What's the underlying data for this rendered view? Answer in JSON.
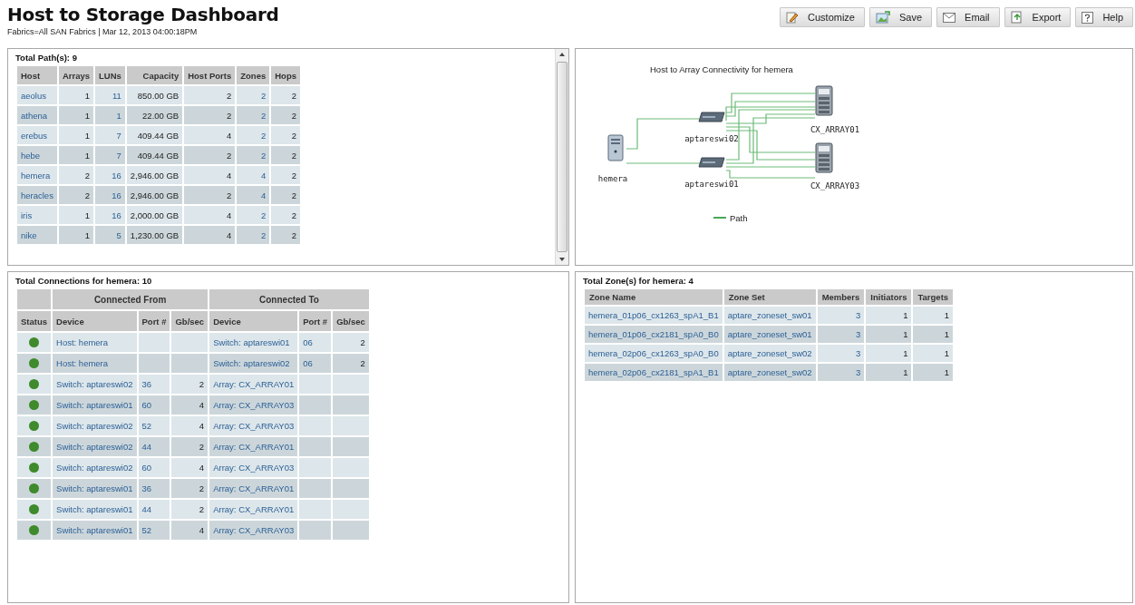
{
  "header": {
    "title": "Host to Storage Dashboard",
    "subtitle": "Fabrics=All SAN Fabrics | Mar 12, 2013 04:00:18PM"
  },
  "toolbar": [
    {
      "kind": "customize",
      "label": "Customize"
    },
    {
      "kind": "save",
      "label": "Save"
    },
    {
      "kind": "email",
      "label": "Email"
    },
    {
      "kind": "export",
      "label": "Export"
    },
    {
      "kind": "help",
      "label": "Help"
    }
  ],
  "paths_panel": {
    "caption": "Total Path(s): 9",
    "columns": [
      "Host",
      "Arrays",
      "LUNs",
      "Capacity",
      "Host Ports",
      "Zones",
      "Hops"
    ],
    "rows": [
      [
        "aeolus",
        "1",
        "11",
        "850.00 GB",
        "2",
        "2",
        "2"
      ],
      [
        "athena",
        "1",
        "1",
        "22.00 GB",
        "2",
        "2",
        "2"
      ],
      [
        "erebus",
        "1",
        "7",
        "409.44 GB",
        "4",
        "2",
        "2"
      ],
      [
        "hebe",
        "1",
        "7",
        "409.44 GB",
        "2",
        "2",
        "2"
      ],
      [
        "hemera",
        "2",
        "16",
        "2,946.00 GB",
        "4",
        "4",
        "2"
      ],
      [
        "heracles",
        "2",
        "16",
        "2,946.00 GB",
        "2",
        "4",
        "2"
      ],
      [
        "iris",
        "1",
        "16",
        "2,000.00 GB",
        "4",
        "2",
        "2"
      ],
      [
        "nike",
        "1",
        "5",
        "1,230.00 GB",
        "4",
        "2",
        "2"
      ]
    ]
  },
  "diagram": {
    "title": "Host to Array Connectivity for hemera",
    "nodes": [
      {
        "kind": "host",
        "label": "hemera"
      },
      {
        "kind": "switch",
        "label": "aptareswi02"
      },
      {
        "kind": "switch",
        "label": "aptareswi01"
      },
      {
        "kind": "array",
        "label": "CX_ARRAY01"
      },
      {
        "kind": "array",
        "label": "CX_ARRAY03"
      }
    ],
    "legend": "Path"
  },
  "connections_panel": {
    "caption": "Total Connections for hemera: 10",
    "groups": [
      "Connected From",
      "Connected To"
    ],
    "columns": [
      "Status",
      "Device",
      "Port #",
      "Gb/sec",
      "Device",
      "Port #",
      "Gb/sec"
    ],
    "rows": [
      {
        "color": "#3e8a2c",
        "cells": [
          "",
          "Host: hemera",
          "",
          "",
          "Switch: aptareswi01",
          "06",
          "2"
        ]
      },
      {
        "color": "#3e8a2c",
        "cells": [
          "",
          "Host: hemera",
          "",
          "",
          "Switch: aptareswi02",
          "06",
          "2"
        ]
      },
      {
        "color": "#3e8a2c",
        "cells": [
          "",
          "Switch: aptareswi02",
          "36",
          "2",
          "Array: CX_ARRAY01",
          "",
          ""
        ]
      },
      {
        "color": "#3e8a2c",
        "cells": [
          "",
          "Switch: aptareswi01",
          "60",
          "4",
          "Array: CX_ARRAY03",
          "",
          ""
        ]
      },
      {
        "color": "#3e8a2c",
        "cells": [
          "",
          "Switch: aptareswi02",
          "52",
          "4",
          "Array: CX_ARRAY03",
          "",
          ""
        ]
      },
      {
        "color": "#3e8a2c",
        "cells": [
          "",
          "Switch: aptareswi02",
          "44",
          "2",
          "Array: CX_ARRAY01",
          "",
          ""
        ]
      },
      {
        "color": "#3e8a2c",
        "cells": [
          "",
          "Switch: aptareswi02",
          "60",
          "4",
          "Array: CX_ARRAY03",
          "",
          ""
        ]
      },
      {
        "color": "#3e8a2c",
        "cells": [
          "",
          "Switch: aptareswi01",
          "36",
          "2",
          "Array: CX_ARRAY01",
          "",
          ""
        ]
      },
      {
        "color": "#3e8a2c",
        "cells": [
          "",
          "Switch: aptareswi01",
          "44",
          "2",
          "Array: CX_ARRAY01",
          "",
          ""
        ]
      },
      {
        "color": "#3e8a2c",
        "cells": [
          "",
          "Switch: aptareswi01",
          "52",
          "4",
          "Array: CX_ARRAY03",
          "",
          ""
        ]
      }
    ]
  },
  "zones_panel": {
    "caption": "Total Zone(s) for hemera: 4",
    "columns": [
      "Zone Name",
      "Zone Set",
      "Members",
      "Initiators",
      "Targets"
    ],
    "rows": [
      [
        "hemera_01p06_cx1263_spA1_B1",
        "aptare_zoneset_sw01",
        "3",
        "1",
        "1"
      ],
      [
        "hemera_01p06_cx2181_spA0_B0",
        "aptare_zoneset_sw01",
        "3",
        "1",
        "1"
      ],
      [
        "hemera_02p06_cx1263_spA0_B0",
        "aptare_zoneset_sw02",
        "3",
        "1",
        "1"
      ],
      [
        "hemera_02p06_cx2181_spA1_B1",
        "aptare_zoneset_sw02",
        "3",
        "1",
        "1"
      ]
    ]
  }
}
